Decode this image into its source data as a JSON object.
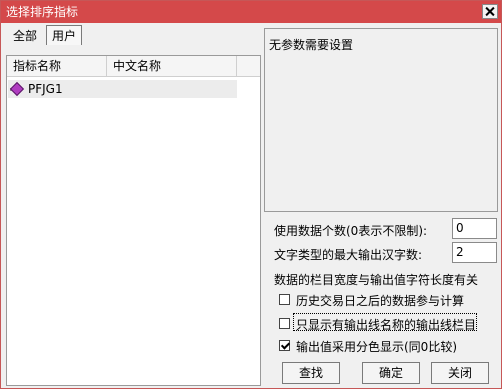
{
  "window": {
    "title": "选择排序指标"
  },
  "tabs": [
    {
      "label": "全部",
      "active": false
    },
    {
      "label": "用户",
      "active": true
    }
  ],
  "list": {
    "headers": [
      "指标名称",
      "中文名称"
    ],
    "rows": [
      {
        "name": "PFJG1",
        "cn_name": ""
      }
    ]
  },
  "description": "无参数需要设置",
  "settings": {
    "count_label": "使用数据个数(0表示不限制):",
    "count_value": "0",
    "max_chars_label": "文字类型的最大输出汉字数:",
    "max_chars_value": "2",
    "width_note": "数据的栏目宽度与输出值字符长度有关",
    "options": [
      {
        "label": "历史交易日之后的数据参与计算",
        "checked": false
      },
      {
        "label": "只显示有输出线名称的输出线栏目",
        "checked": false
      },
      {
        "label": "输出值采用分色显示(同0比较)",
        "checked": true
      }
    ]
  },
  "buttons": {
    "find": "查找",
    "ok": "确定",
    "close": "关闭"
  },
  "colors": {
    "titlebar": "#d4494a",
    "indicator_icon": "#b03cc0"
  }
}
